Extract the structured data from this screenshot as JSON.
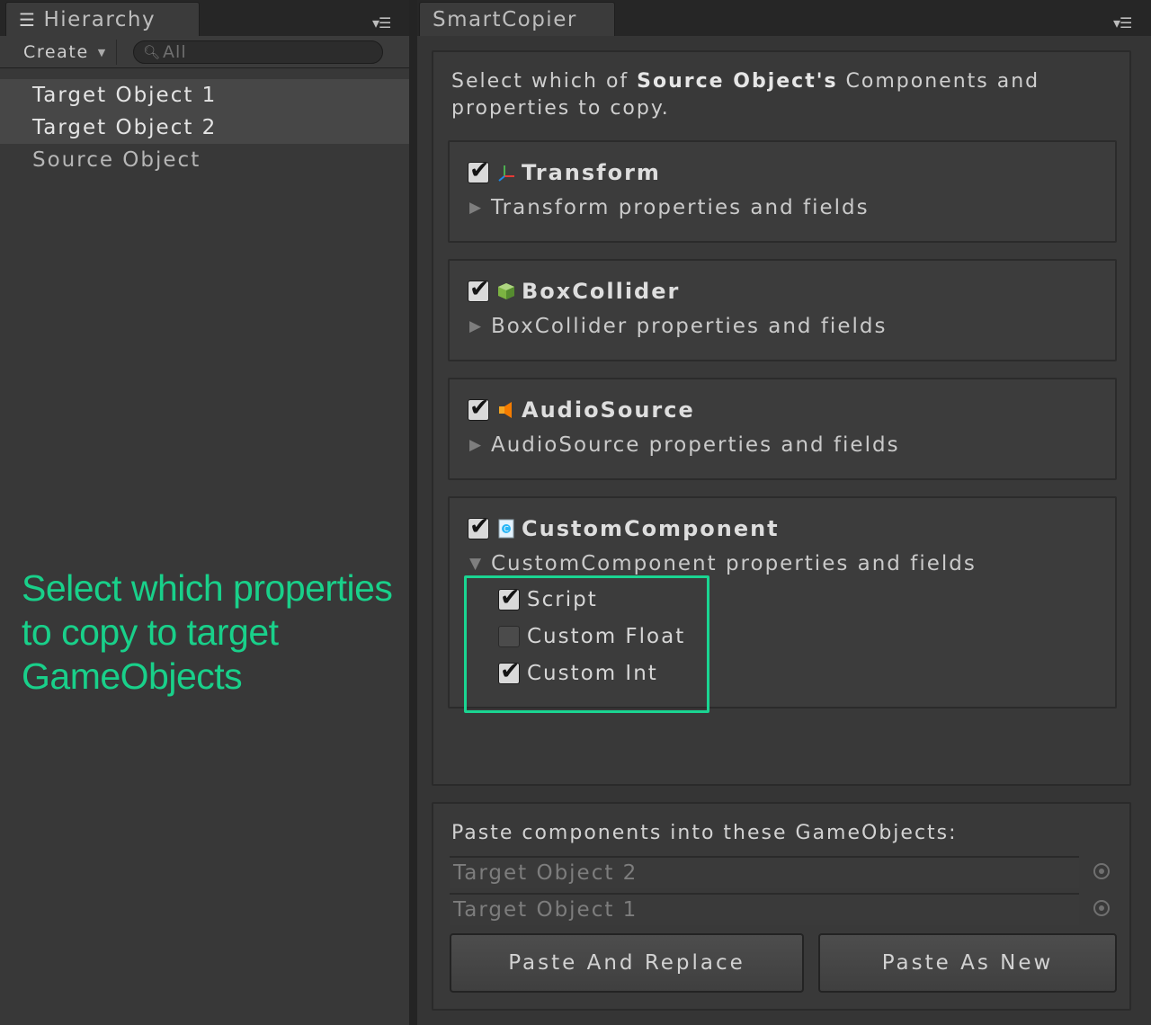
{
  "hierarchy": {
    "tab_title": "Hierarchy",
    "create_label": "Create",
    "search_placeholder": "All",
    "items": [
      {
        "label": "Target Object 1",
        "selected": true
      },
      {
        "label": "Target Object 2",
        "selected": true
      },
      {
        "label": "Source Object",
        "selected": false
      }
    ]
  },
  "annotation": {
    "line1": "Select which properties",
    "line2": "to copy to target",
    "line3": "GameObjects"
  },
  "smartcopier": {
    "tab_title": "SmartCopier",
    "intro_prefix": "Select which of ",
    "intro_bold": "Source Object's",
    "intro_suffix": " Components and properties to copy.",
    "components": [
      {
        "name": "Transform",
        "checked": true,
        "icon": "transform-axes-icon",
        "subtitle": "Transform properties and fields",
        "expanded": false
      },
      {
        "name": "BoxCollider",
        "checked": true,
        "icon": "box-collider-icon",
        "subtitle": "BoxCollider properties and fields",
        "expanded": false
      },
      {
        "name": "AudioSource",
        "checked": true,
        "icon": "audio-source-speaker-icon",
        "subtitle": "AudioSource properties and fields",
        "expanded": false
      },
      {
        "name": "CustomComponent",
        "checked": true,
        "icon": "script-icon",
        "subtitle": "CustomComponent properties and fields",
        "expanded": true,
        "properties": [
          {
            "label": "Script",
            "checked": true
          },
          {
            "label": "Custom Float",
            "checked": false
          },
          {
            "label": "Custom Int",
            "checked": true
          }
        ]
      }
    ],
    "paste_label": "Paste components into these GameObjects:",
    "targets": [
      "Target Object 2",
      "Target Object 1"
    ],
    "buttons": {
      "paste_replace": "Paste And Replace",
      "paste_new": "Paste As New"
    }
  },
  "colors": {
    "annotation": "#19d08a",
    "highlight_box": "#1ad592",
    "panel_bg": "#353535"
  }
}
